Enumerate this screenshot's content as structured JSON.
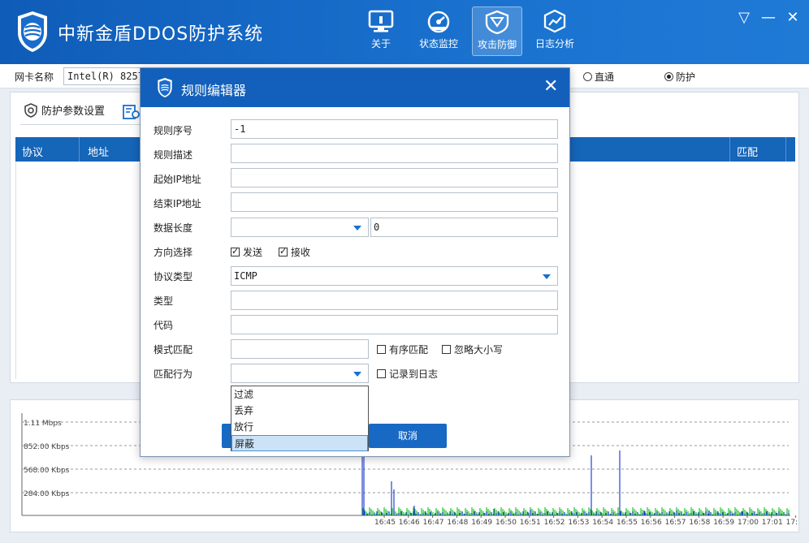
{
  "app": {
    "title": "中新金盾DDOS防护系统"
  },
  "nav": [
    {
      "label": "关于",
      "icon": "monitor-icon"
    },
    {
      "label": "状态监控",
      "icon": "gauge-icon"
    },
    {
      "label": "攻击防御",
      "icon": "shield-filter-icon",
      "active": true
    },
    {
      "label": "日志分析",
      "icon": "chart-icon"
    }
  ],
  "window_controls": {
    "menu": "▽",
    "minimize": "—",
    "close": "✕"
  },
  "nic": {
    "label": "网卡名称",
    "value": "Intel(R) 8257"
  },
  "mode": {
    "bypass": "直通",
    "protect": "防护",
    "selected": "protect"
  },
  "tabs": {
    "defense_params": "防护参数设置"
  },
  "table": {
    "headers": [
      "协议",
      "地址",
      "匹配"
    ]
  },
  "graph": {
    "y_ticks": [
      "1.11 Mbps",
      "852.00 Kbps",
      "568.00 Kbps",
      "284.00 Kbps"
    ],
    "x_ticks": [
      "16:45",
      "16:46",
      "16:47",
      "16:48",
      "16:49",
      "16:50",
      "16:51",
      "16:52",
      "16:53",
      "16:54",
      "16:55",
      "16:56",
      "16:57",
      "16:58",
      "16:59",
      "17:00",
      "17:01",
      "17:"
    ],
    "series_colors": {
      "rx": "#22c22a",
      "tx": "#1133cc"
    }
  },
  "dialog": {
    "title": "规则编辑器",
    "fields": {
      "rule_no": {
        "label": "规则序号",
        "value": "-1"
      },
      "rule_desc": {
        "label": "规则描述",
        "value": ""
      },
      "start_ip": {
        "label": "起始IP地址",
        "value": ""
      },
      "end_ip": {
        "label": "结束IP地址",
        "value": ""
      },
      "data_len": {
        "label": "数据长度",
        "value": "",
        "value2": "0"
      },
      "direction": {
        "label": "方向选择",
        "send": "发送",
        "recv": "接收"
      },
      "protocol": {
        "label": "协议类型",
        "value": "ICMP"
      },
      "type": {
        "label": "类型",
        "value": ""
      },
      "code": {
        "label": "代码",
        "value": ""
      },
      "pattern": {
        "label": "模式匹配",
        "value": "",
        "ordered": "有序匹配",
        "ignore_case": "忽略大小写"
      },
      "action": {
        "label": "匹配行为",
        "value": "",
        "log": "记录到日志"
      }
    },
    "action_options": [
      "过滤",
      "丢弃",
      "放行",
      "屏蔽"
    ],
    "action_highlighted": "屏蔽",
    "ok_label": "",
    "cancel_label": "取消"
  }
}
